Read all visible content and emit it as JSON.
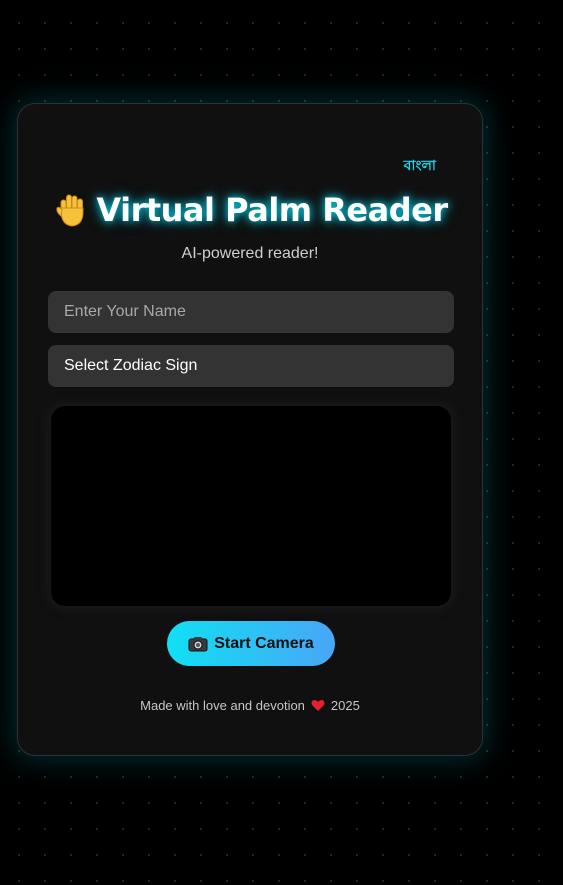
{
  "header": {
    "language_toggle": "বাংলা",
    "title": "Virtual Palm Reader",
    "title_icon": "raised-hand-icon",
    "subtitle": "AI-powered reader!"
  },
  "form": {
    "name_placeholder": "Enter Your Name",
    "name_value": "",
    "zodiac_selected": "Select Zodiac Sign"
  },
  "camera": {
    "button_label": "Start Camera",
    "button_icon": "camera-icon"
  },
  "footer": {
    "text": "Made with love and devotion",
    "icon": "heart-icon",
    "year": "2025"
  },
  "colors": {
    "accent": "#14d4ec",
    "button_gradient_start": "#10e0f4",
    "button_gradient_end": "#49a6f6",
    "card_bg": "#101010",
    "field_bg": "#333333",
    "heart": "#e8202e"
  }
}
